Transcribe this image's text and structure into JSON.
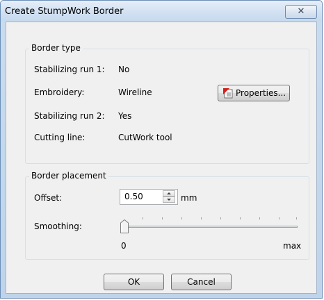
{
  "window": {
    "title": "Create StumpWork Border",
    "close_glyph": "✕"
  },
  "border_type": {
    "legend": "Border type",
    "rows": [
      {
        "label": "Stabilizing run 1:",
        "value": "No"
      },
      {
        "label": "Embroidery:",
        "value": "Wireline"
      },
      {
        "label": "Stabilizing run 2:",
        "value": "Yes"
      },
      {
        "label": "Cutting line:",
        "value": "CutWork tool"
      }
    ],
    "properties_button": {
      "label": "Properties...",
      "icon": "properties-icon"
    }
  },
  "border_placement": {
    "legend": "Border placement",
    "offset": {
      "label": "Offset:",
      "value": "0.50",
      "unit": "mm"
    },
    "smoothing": {
      "label": "Smoothing:",
      "min_label": "0",
      "max_label": "max",
      "level": 0
    }
  },
  "buttons": {
    "ok": "OK",
    "cancel": "Cancel"
  },
  "colors": {
    "titlebar": "#c6d9ee",
    "dialog_bg": "#f0f0f0",
    "group_border": "#d5dfe5"
  }
}
